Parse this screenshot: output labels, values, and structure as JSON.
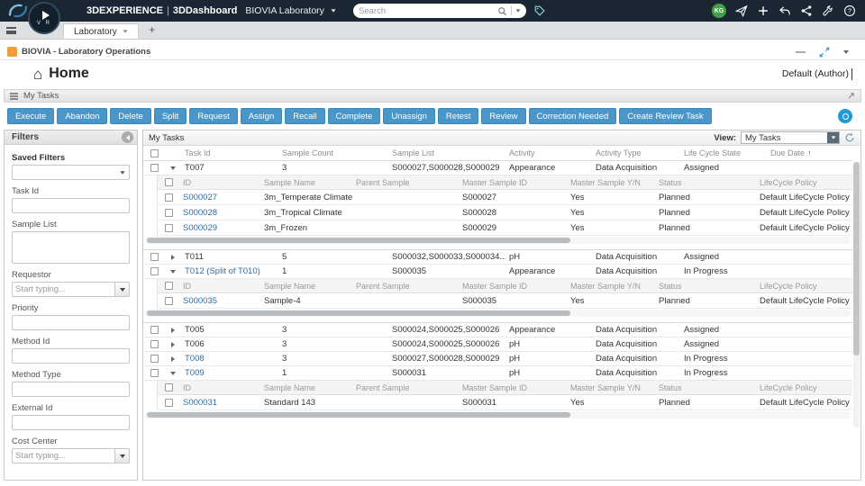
{
  "theme": {
    "topbar-bg": "#1a2733",
    "accent-blue": "#4a96c8",
    "link-blue": "#2e6da4",
    "info-blue": "#1f9ad6",
    "avatar-green": "#43a047",
    "expand-blue": "#2a8fd0",
    "tag-teal": "#8fd4e8",
    "biovia-orange": "#f09d3a"
  },
  "topbar": {
    "brand": "3DEXPERIENCE",
    "separator": "|",
    "product": "3DDashboard",
    "app": "BIOVIA Laboratory",
    "search_placeholder": "Search",
    "avatar": "KG",
    "icons": [
      "paper-plane",
      "plus",
      "reply",
      "share-nodes",
      "tools",
      "help"
    ]
  },
  "tabbar": {
    "tab": "Laboratory",
    "add_label": "+"
  },
  "widget": {
    "header_title": "BIOVIA - Laboratory Operations",
    "page_title": "Home",
    "context": "Default (Author)",
    "section_title": "My Tasks"
  },
  "toolbar": {
    "buttons": [
      "Execute",
      "Abandon",
      "Delete",
      "Split",
      "Request",
      "Assign",
      "Recall",
      "Complete",
      "Unassign",
      "Retest",
      "Review",
      "Correction Needed",
      "Create Review Task"
    ]
  },
  "filters": {
    "title": "Filters",
    "fields": [
      {
        "label": "Saved Filters",
        "type": "select",
        "value": ""
      },
      {
        "label": "Task Id",
        "type": "input",
        "value": ""
      },
      {
        "label": "Sample List",
        "type": "textarea",
        "value": ""
      },
      {
        "label": "Requestor",
        "type": "combo",
        "placeholder": "Start typing..."
      },
      {
        "label": "Priority",
        "type": "input",
        "value": ""
      },
      {
        "label": "Method Id",
        "type": "input",
        "value": ""
      },
      {
        "label": "Method Type",
        "type": "input",
        "value": ""
      },
      {
        "label": "External Id",
        "type": "input",
        "value": ""
      },
      {
        "label": "Cost Center",
        "type": "combo",
        "placeholder": "Start typing..."
      }
    ]
  },
  "grid": {
    "title": "My Tasks",
    "view_label": "View:",
    "view_value": "My Tasks",
    "sort_arrow": "↑",
    "columns": [
      "Task Id",
      "Sample Count",
      "Sample List",
      "Activity",
      "Activity Type",
      "Life Cycle State",
      "Due Date"
    ],
    "sub_columns": [
      "ID",
      "Sample Name",
      "Parent Sample",
      "Master Sample ID",
      "Master Sample Y/N",
      "Status",
      "LifeCycle Policy"
    ],
    "tasks": [
      {
        "id": "T007",
        "expanded": true,
        "link": false,
        "sample_count": "3",
        "sample_list": "S000027,S000028,S000029",
        "activity": "Appearance",
        "activity_type": "Data Acquisition",
        "life_cycle_state": "Assigned",
        "due_date": "",
        "gap_after": true,
        "samples": [
          {
            "id": "S000027",
            "name": "3m_Temperate Climate",
            "parent": "",
            "master_id": "S000027",
            "master_yn": "Yes",
            "status": "Planned",
            "policy": "Default LifeCycle Policy"
          },
          {
            "id": "S000028",
            "name": "3m_Tropical Climate",
            "parent": "",
            "master_id": "S000028",
            "master_yn": "Yes",
            "status": "Planned",
            "policy": "Default LifeCycle Policy"
          },
          {
            "id": "S000029",
            "name": "3m_Frozen",
            "parent": "",
            "master_id": "S000029",
            "master_yn": "Yes",
            "status": "Planned",
            "policy": "Default LifeCycle Policy"
          }
        ]
      },
      {
        "id": "T011",
        "expanded": false,
        "link": false,
        "sample_count": "5",
        "sample_list": "S000032,S000033,S000034...",
        "activity": "pH",
        "activity_type": "Data Acquisition",
        "life_cycle_state": "Assigned",
        "due_date": ""
      },
      {
        "id": "T012 (Split of T010)",
        "expanded": true,
        "link": true,
        "sample_count": "1",
        "sample_list": "S000035",
        "activity": "Appearance",
        "activity_type": "Data Acquisition",
        "life_cycle_state": "In Progress",
        "due_date": "",
        "gap_after": true,
        "samples": [
          {
            "id": "S000035",
            "name": "Sample-4",
            "parent": "",
            "master_id": "S000035",
            "master_yn": "Yes",
            "status": "Planned",
            "policy": "Default LifeCycle Policy"
          }
        ]
      },
      {
        "id": "T005",
        "expanded": false,
        "link": false,
        "sample_count": "3",
        "sample_list": "S000024,S000025,S000026",
        "activity": "Appearance",
        "activity_type": "Data Acquisition",
        "life_cycle_state": "Assigned",
        "due_date": ""
      },
      {
        "id": "T006",
        "expanded": false,
        "link": false,
        "sample_count": "3",
        "sample_list": "S000024,S000025,S000026",
        "activity": "pH",
        "activity_type": "Data Acquisition",
        "life_cycle_state": "Assigned",
        "due_date": ""
      },
      {
        "id": "T008",
        "expanded": false,
        "link": true,
        "sample_count": "3",
        "sample_list": "S000027,S000028,S000029",
        "activity": "pH",
        "activity_type": "Data Acquisition",
        "life_cycle_state": "In Progress",
        "due_date": ""
      },
      {
        "id": "T009",
        "expanded": true,
        "link": true,
        "sample_count": "1",
        "sample_list": "S000031",
        "activity": "pH",
        "activity_type": "Data Acquisition",
        "life_cycle_state": "In Progress",
        "due_date": "",
        "samples": [
          {
            "id": "S000031",
            "name": "Standard 143",
            "parent": "",
            "master_id": "S000031",
            "master_yn": "Yes",
            "status": "Planned",
            "policy": "Default LifeCycle Policy"
          }
        ]
      }
    ]
  }
}
